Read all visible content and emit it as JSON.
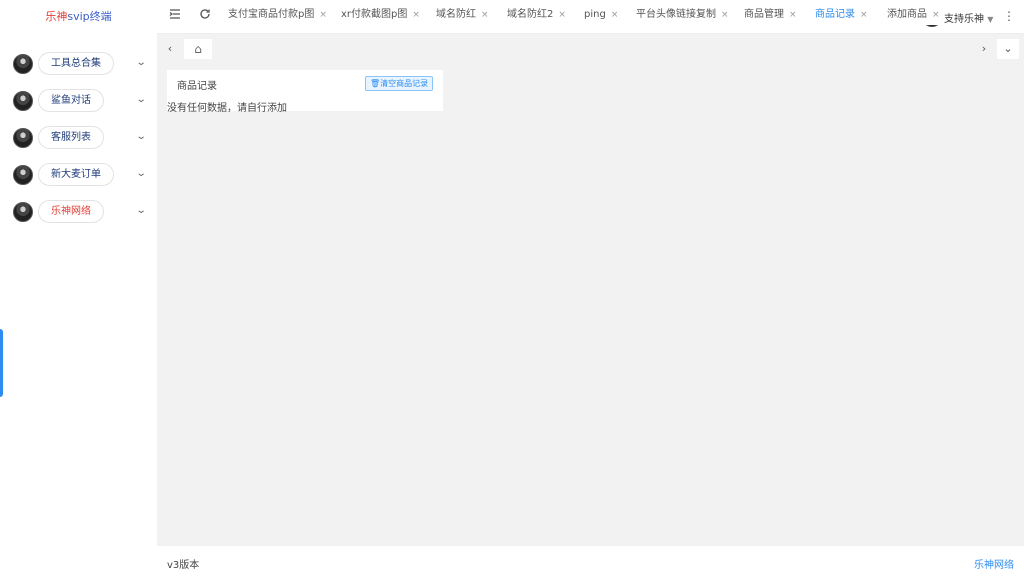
{
  "logo": {
    "part1": "乐神",
    "part2": "svip终端"
  },
  "sidebar": {
    "items": [
      {
        "label": "工具总合集",
        "color": "#1f3c7a"
      },
      {
        "label": "鲨鱼对话",
        "color": "#1f3c7a"
      },
      {
        "label": "客服列表",
        "color": "#1f3c7a"
      },
      {
        "label": "新大麦订单",
        "color": "#1f3c7a"
      },
      {
        "label": "乐神网络",
        "color": "#e33e33"
      }
    ]
  },
  "header": {
    "user_name": "支持乐神",
    "icons": [
      "menu-fold-icon",
      "refresh-icon",
      "fullscreen-icon",
      "lock-icon",
      "more-icon"
    ]
  },
  "tabs": {
    "items": [
      {
        "label": "支付宝商品付款p图"
      },
      {
        "label": "xr付款截图p图"
      },
      {
        "label": "域名防红"
      },
      {
        "label": "域名防红2"
      },
      {
        "label": "ping"
      },
      {
        "label": "平台头像链接复制"
      },
      {
        "label": "商品管理"
      },
      {
        "label": "商品记录"
      },
      {
        "label": "添加商品"
      }
    ],
    "active_index": 7,
    "close_symbol": "×"
  },
  "content": {
    "card_title": "商品记录",
    "clear_button": "清空商品记录",
    "empty_text": "没有任何数据，请自行添加"
  },
  "footer": {
    "version": "v3版本",
    "brand": "乐神网络"
  },
  "colors": {
    "accent": "#2d8cf0",
    "brand_red": "#e33e33",
    "brand_blue": "#3a5ec8"
  }
}
